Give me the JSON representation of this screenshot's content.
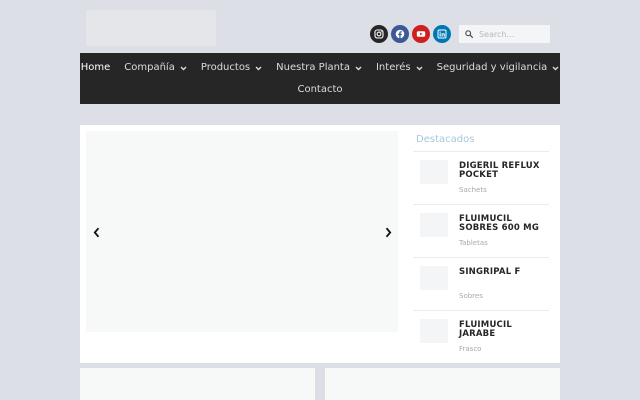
{
  "search": {
    "placeholder": "Search..."
  },
  "social": [
    {
      "icon": "instagram-icon",
      "color": "#262626"
    },
    {
      "icon": "facebook-icon",
      "color": "#3b5998"
    },
    {
      "icon": "youtube-icon",
      "color": "#cd201f"
    },
    {
      "icon": "linkedin-icon",
      "color": "#0077b5"
    }
  ],
  "nav": {
    "items": [
      {
        "label": "Home",
        "dropdown": false,
        "active": true
      },
      {
        "label": "Compañía",
        "dropdown": true
      },
      {
        "label": "Productos",
        "dropdown": true
      },
      {
        "label": "Nuestra Planta",
        "dropdown": true
      },
      {
        "label": "Interés",
        "dropdown": true
      },
      {
        "label": "Seguridad y vigilancia",
        "dropdown": true
      },
      {
        "label": "Contacto",
        "dropdown": false
      }
    ],
    "background": "#262626"
  },
  "featured": {
    "title": "Destacados",
    "title_color": "#a7c8dd",
    "products": [
      {
        "name": "DIGERIL REFLUX POCKET",
        "category": "Sachets"
      },
      {
        "name": "FLUIMUCIL SOBRES 600 MG",
        "category": "Tabletas"
      },
      {
        "name": "SINGRIPAL F",
        "category": "Sobres"
      },
      {
        "name": "FLUIMUCIL JARABE",
        "category": "Frasco"
      }
    ]
  },
  "slider": {
    "prev_icon": "chevron-left-icon",
    "next_icon": "chevron-right-icon"
  }
}
